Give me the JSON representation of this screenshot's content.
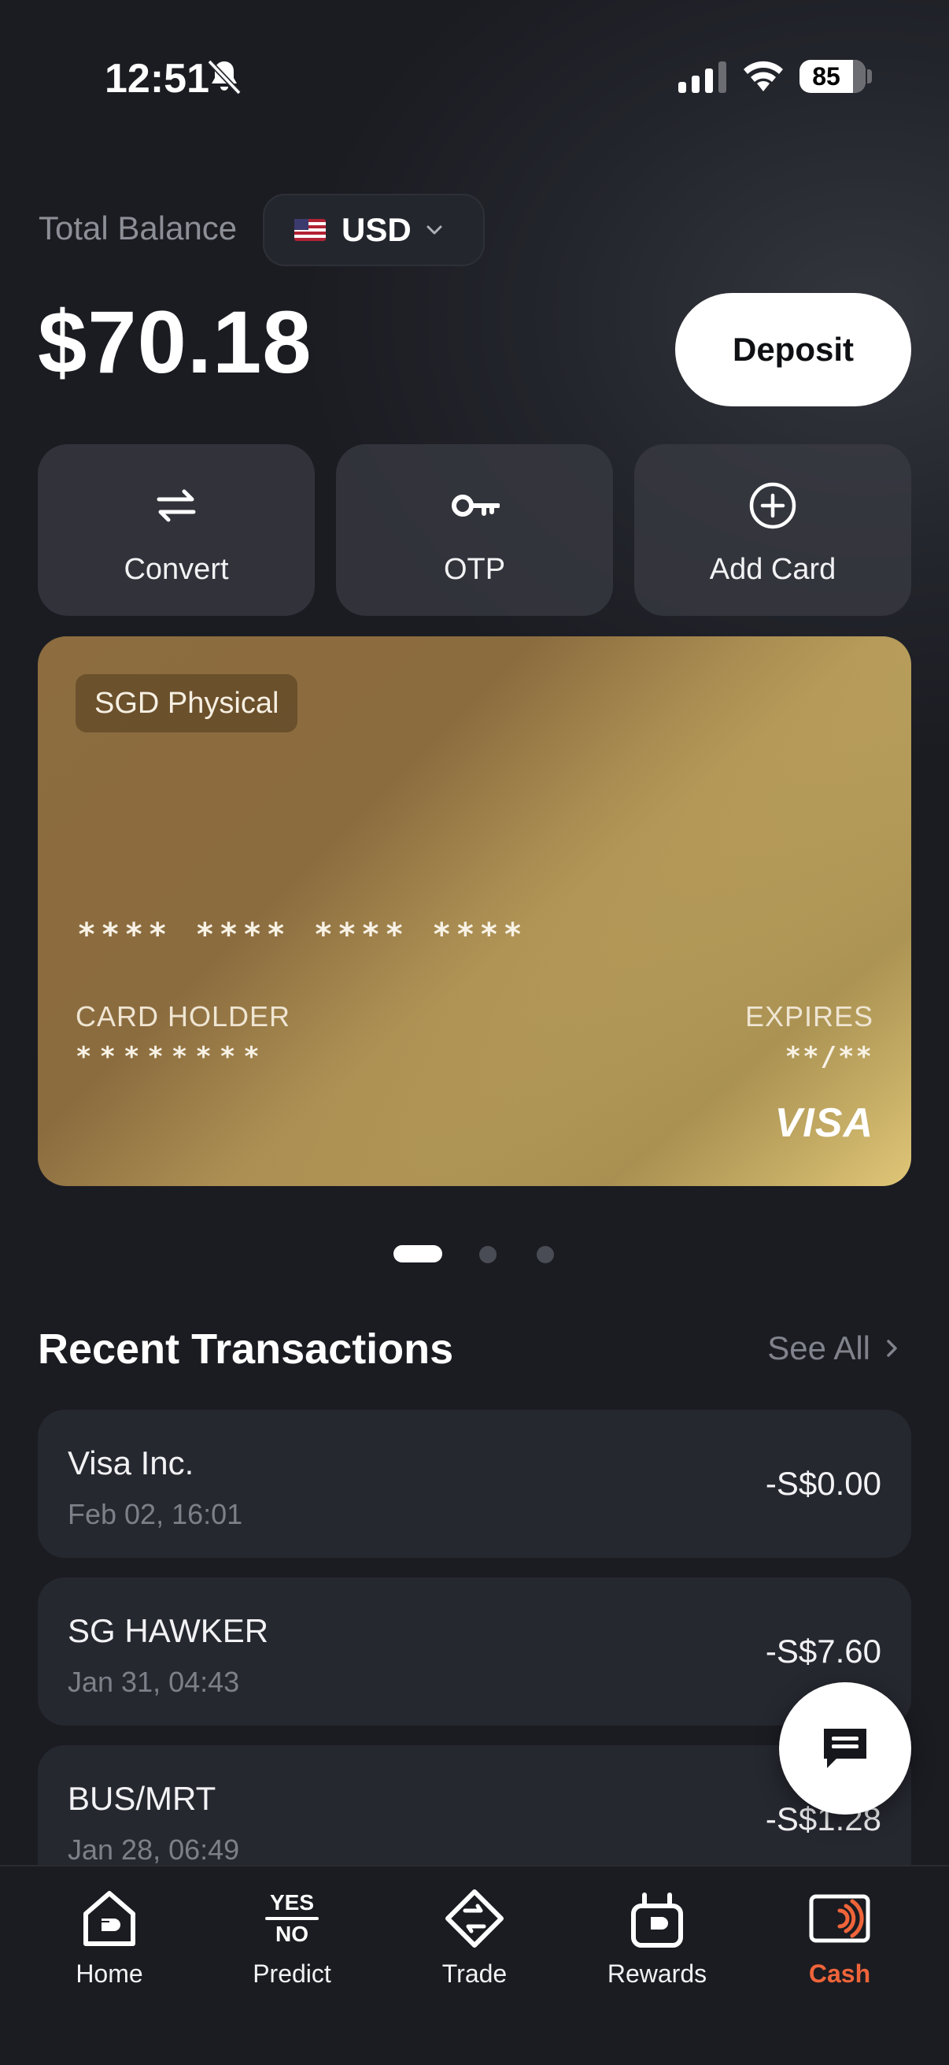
{
  "status_bar": {
    "time": "12:51",
    "battery": "85"
  },
  "balance": {
    "label": "Total Balance",
    "currency": "USD",
    "amount": "$70.18",
    "deposit_label": "Deposit"
  },
  "actions": [
    {
      "label": "Convert",
      "icon": "swap-arrows-icon"
    },
    {
      "label": "OTP",
      "icon": "key-icon"
    },
    {
      "label": "Add Card",
      "icon": "plus-circle-icon"
    }
  ],
  "card": {
    "type": "SGD Physical",
    "number": "**** **** **** ****",
    "holder_label": "CARD HOLDER",
    "holder_value": "********",
    "expires_label": "EXPIRES",
    "expires_value": "**/**",
    "network": "VISA",
    "gradient_start": "#8d6d3f",
    "gradient_end": "#f4dc86"
  },
  "pager": {
    "count": 3,
    "active": 0
  },
  "transactions": {
    "title": "Recent Transactions",
    "see_all": "See All",
    "items": [
      {
        "name": "Visa Inc.",
        "date": "Feb 02, 16:01",
        "amount": "-S$0.00"
      },
      {
        "name": "SG HAWKER",
        "date": "Jan 31, 04:43",
        "amount": "-S$7.60"
      },
      {
        "name": "BUS/MRT",
        "date": "Jan 28, 06:49",
        "amount": "-S$1.28"
      }
    ]
  },
  "nav": {
    "items": [
      {
        "label": "Home",
        "icon": "home-icon"
      },
      {
        "label": "Predict",
        "icon": "yes-no-icon",
        "icon_text_top": "YES",
        "icon_text_bottom": "NO"
      },
      {
        "label": "Trade",
        "icon": "trade-icon"
      },
      {
        "label": "Rewards",
        "icon": "gift-icon"
      },
      {
        "label": "Cash",
        "icon": "card-tap-icon"
      }
    ],
    "active": "Cash",
    "active_color": "#f0643a"
  }
}
